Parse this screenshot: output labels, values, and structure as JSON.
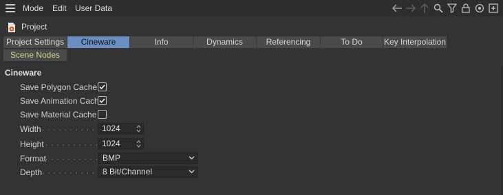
{
  "menu": {
    "items": [
      "Mode",
      "Edit",
      "User Data"
    ]
  },
  "toolbar": {
    "icons": [
      "arrow-left-icon",
      "arrow-right-icon",
      "arrow-up-icon",
      "search-icon",
      "filter-icon",
      "lock-icon",
      "target-icon",
      "new-window-icon"
    ]
  },
  "project": {
    "title": "Project"
  },
  "tabs": [
    {
      "label": "Project Settings",
      "active": false
    },
    {
      "label": "Cineware",
      "active": true
    },
    {
      "label": "Info",
      "active": false
    },
    {
      "label": "Dynamics",
      "active": false
    },
    {
      "label": "Referencing",
      "active": false
    },
    {
      "label": "To Do",
      "active": false
    },
    {
      "label": "Key Interpolation",
      "active": false
    },
    {
      "label": "Scene Nodes",
      "active": false
    }
  ],
  "section": {
    "title": "Cineware"
  },
  "fields": {
    "save_polygon_cache": {
      "label": "Save Polygon Cache",
      "checked": true
    },
    "save_animation_cache": {
      "label": "Save Animation Cache",
      "checked": true
    },
    "save_material_cache": {
      "label": "Save Material Cache",
      "checked": false
    },
    "width": {
      "label": "Width",
      "value": "1024"
    },
    "height": {
      "label": "Height",
      "value": "1024"
    },
    "format": {
      "label": "Format",
      "value": "BMP"
    },
    "depth": {
      "label": "Depth",
      "value": "8 Bit/Channel"
    }
  },
  "colors": {
    "background": "#333333",
    "tab": "#4a4a4a",
    "active_tab": "#6a8fc0",
    "scene_nodes_text": "#d8d08a"
  }
}
